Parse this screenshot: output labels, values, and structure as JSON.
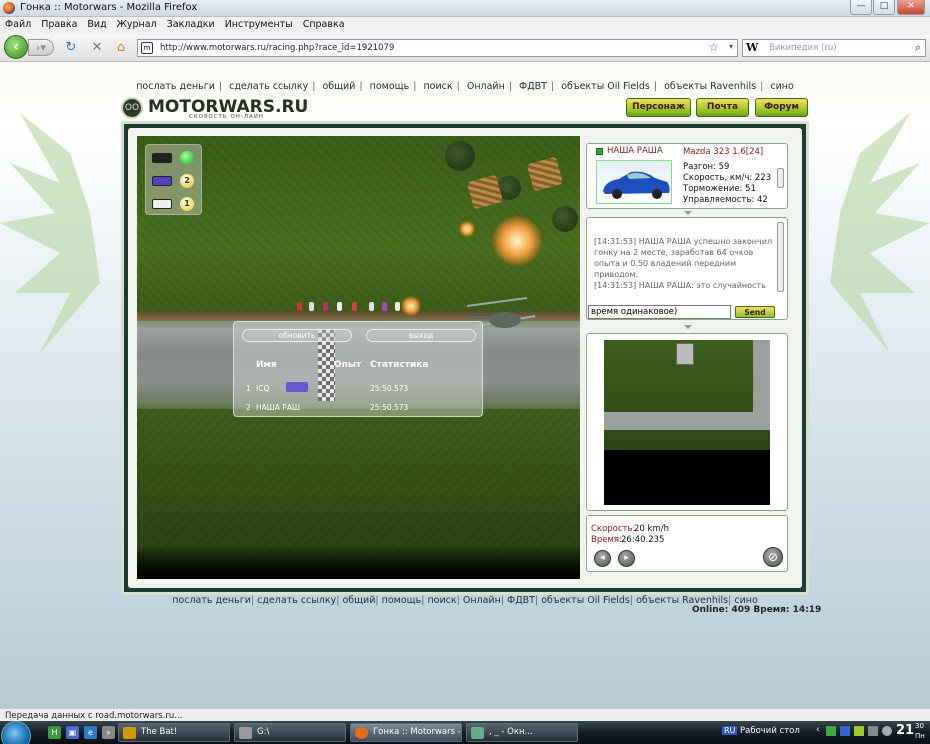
{
  "window": {
    "title": "Гонка :: Motorwars - Mozilla Firefox"
  },
  "menu": [
    "Файл",
    "Правка",
    "Вид",
    "Журнал",
    "Закладки",
    "Инструменты",
    "Справка"
  ],
  "nav": {
    "url": "http://www.motorwars.ru/racing.php?race_id=1921079",
    "search_placeholder": "Википедия (ru)",
    "search_engine_glyph": "W"
  },
  "links": [
    "послать деньги",
    "сделать ссылку",
    "общий",
    "помощь",
    "поиск",
    "Онлайн",
    "ФДВТ",
    "объекты Oil Fields",
    "объекты Ravenhils",
    "сино"
  ],
  "site": {
    "logo": "MOTORWARS.RU",
    "slogan": "СКОРОСТЬ ОН-ЛАЙН",
    "logo_icon": "OO"
  },
  "buttons": {
    "character": "Персонаж",
    "mail": "Почта",
    "forum": "Форум"
  },
  "race": {
    "legend_badges": [
      "",
      "2",
      "1"
    ],
    "refresh": "обновить",
    "exit": "выход",
    "headers": {
      "name": "Имя",
      "exp": "Опыт",
      "stats": "Статистика"
    },
    "rows": [
      {
        "pos": "1",
        "name": "ICQ",
        "exp": "",
        "time": "25:50.573"
      },
      {
        "pos": "2",
        "name": "НАША РАШ",
        "exp": "",
        "time": "25:50.573"
      }
    ]
  },
  "player": {
    "name": "НАША РАША",
    "car": "Mazda 323 1.6[24]",
    "stats": [
      "Разгон: 59",
      "Скорость, км/ч: 223",
      "Торможение: 51",
      "Управляемость: 42"
    ]
  },
  "chat": {
    "messages": [
      "[14:31:53] НАША РАША успешно закончил гонку на 2 месте, заработав 64 очков опыта и 0.50 владений передним приводом.",
      "[14:31:53] НАША РАША: это случайность"
    ],
    "input_value": "время одинаковое)",
    "send": "Send"
  },
  "speed": {
    "speed_label": "Скорость:",
    "speed_value": "20 km/h",
    "time_label": "Время:",
    "time_value": "26:40.235"
  },
  "footer": {
    "online": "Online: 409  Время: 14:19"
  },
  "status": "Передача данных с road.motorwars.ru...",
  "taskbar": {
    "items": [
      "The Bat!",
      "G:\\",
      "Гонка :: Motorwars -...",
      ", _ - Окн..."
    ],
    "tray_lang": "RU",
    "desktop": "Рабочий стол",
    "clock": "21",
    "clock_small": "30",
    "day": "Пн"
  },
  "colors": {
    "accent_red": "#8b1a1a",
    "button_green": "#a8c92c",
    "frame": "#203b36"
  }
}
